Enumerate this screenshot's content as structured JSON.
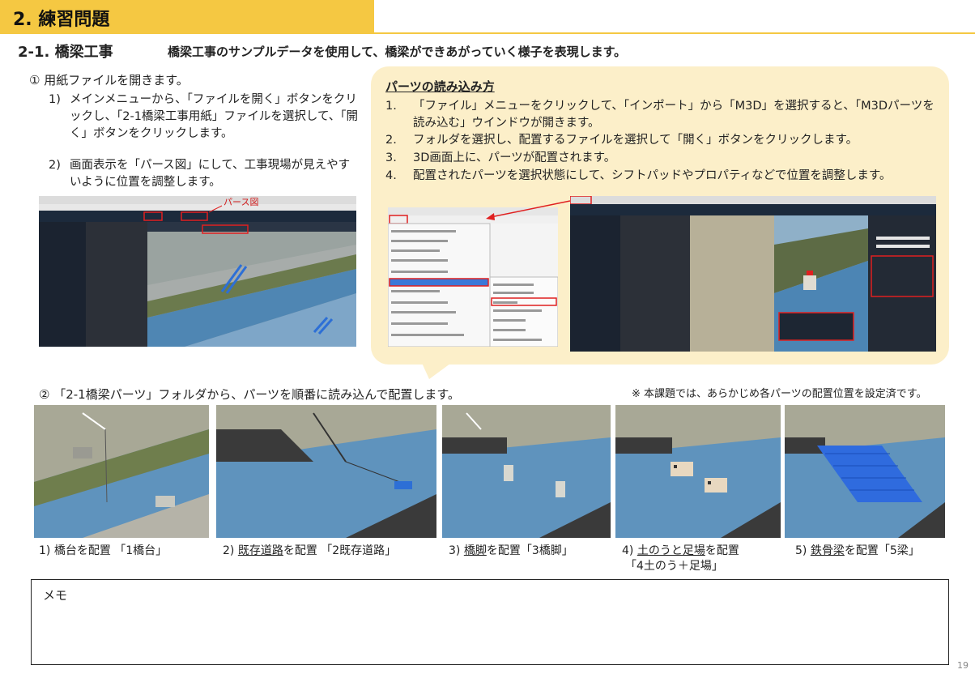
{
  "header": {
    "title": "2. 練習問題",
    "band_color": "#f5c842"
  },
  "section": {
    "title": "2-1. 橋梁工事",
    "description": "橋梁工事のサンプルデータを使用して、橋梁ができあがっていく様子を表現します。"
  },
  "step1": {
    "label": "① 用紙ファイルを開きます。",
    "items": [
      {
        "num": "1)",
        "text": "メインメニューから、「ファイルを開く」ボタンをクリックし、「2-1橋梁工事用紙」ファイルを選択して、「開く」ボタンをクリックします。"
      },
      {
        "num": "2)",
        "text": "画面表示を「パース図」にして、工事現場が見えやすいように位置を調整します。"
      }
    ],
    "screenshot_label": "パース図"
  },
  "callout": {
    "title": "パーツの読み込み方",
    "items": [
      {
        "num": "1.",
        "text": "「ファイル」メニューをクリックして、「インポート」から「M3D」を選択すると、「M3Dパーツを読み込む」ウインドウが開きます。"
      },
      {
        "num": "2.",
        "text": "フォルダを選択し、配置するファイルを選択して「開く」ボタンをクリックします。"
      },
      {
        "num": "3.",
        "text": "3D画面上に、パーツが配置されます。"
      },
      {
        "num": "4.",
        "text": "配置されたパーツを選択状態にして、シフトパッドやプロパティなどで位置を調整します。"
      }
    ],
    "bg_color": "#fcefc9"
  },
  "step2": {
    "label": "② 「2-1橋梁パーツ」フォルダから、パーツを順番に読み込んで配置します。",
    "note": "※ 本課題では、あらかじめ各パーツの配置位置を設定済です。"
  },
  "captions": [
    {
      "pre": "1) 橋台を配置 「1橋台」",
      "u": "",
      "post": "",
      "line2": ""
    },
    {
      "pre": "2) ",
      "u": "既存道路",
      "post": "を配置 「2既存道路」",
      "line2": ""
    },
    {
      "pre": "3) ",
      "u": "橋脚",
      "post": "を配置「3橋脚」",
      "line2": ""
    },
    {
      "pre": "4) ",
      "u": "土のうと足場",
      "post": "を配置",
      "line2": "「4土のう＋足場」"
    },
    {
      "pre": "5) ",
      "u": "鉄骨梁",
      "post": "を配置「5梁」",
      "line2": ""
    }
  ],
  "memo": {
    "label": "メモ"
  },
  "page_number": "19"
}
